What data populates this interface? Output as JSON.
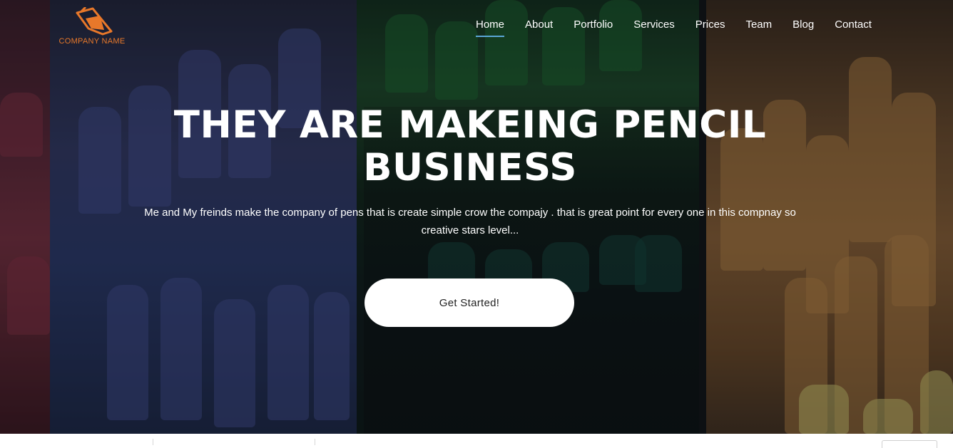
{
  "brand": {
    "name": "COMPANY NAME",
    "logo_icon": "pencil-logo-icon",
    "accent_color": "#e8782a"
  },
  "nav": {
    "items": [
      {
        "label": "Home",
        "active": true
      },
      {
        "label": "About"
      },
      {
        "label": "Portfolio"
      },
      {
        "label": "Services"
      },
      {
        "label": "Prices"
      },
      {
        "label": "Team"
      },
      {
        "label": "Blog"
      },
      {
        "label": "Contact"
      }
    ],
    "active_underline_color": "#5aa6d6"
  },
  "hero": {
    "headline_line1": "THEY ARE MAKEING PENCIL",
    "headline_line2": "BUSINESS",
    "subtext": "Me and My freinds make the company of pens that is create simple crow the compajy . that is great point for every one in this compnay so creative stars level...",
    "cta_label": "Get Started!"
  }
}
